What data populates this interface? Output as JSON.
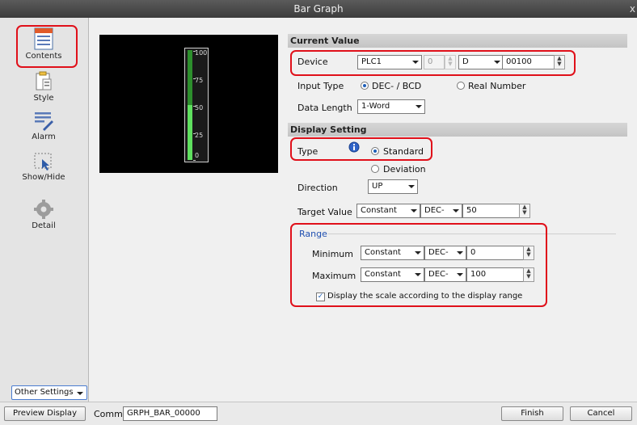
{
  "window": {
    "title": "Bar Graph",
    "close": "x"
  },
  "sidebar": {
    "items": [
      {
        "label": "Contents",
        "icon": "contents-icon",
        "selected": true
      },
      {
        "label": "Style",
        "icon": "style-icon"
      },
      {
        "label": "Alarm",
        "icon": "alarm-icon"
      },
      {
        "label": "Show/Hide",
        "icon": "show-hide-icon"
      },
      {
        "label": "Detail",
        "icon": "detail-icon"
      }
    ],
    "other_settings": "Other Settings"
  },
  "preview": {
    "scale": [
      "100",
      "75",
      "50",
      "25",
      "0"
    ],
    "fill_fraction": 0.5,
    "bar_color": "#2d8f2d",
    "fill_color": "#5fe05f"
  },
  "current_value": {
    "title": "Current Value",
    "device_label": "Device",
    "device": "PLC1",
    "station": "0",
    "device_type": "D",
    "address": "00100",
    "input_type_label": "Input Type",
    "input_dec": "DEC- / BCD",
    "input_real": "Real Number",
    "data_length_label": "Data Length",
    "data_length": "1-Word"
  },
  "display_setting": {
    "title": "Display Setting",
    "type_label": "Type",
    "standard": "Standard",
    "deviation": "Deviation",
    "direction_label": "Direction",
    "direction": "UP",
    "target_label": "Target Value",
    "target_mode": "Constant",
    "target_format": "DEC-",
    "target_value": "50"
  },
  "range": {
    "title": "Range",
    "min_label": "Minimum",
    "min_mode": "Constant",
    "min_format": "DEC-",
    "min_value": "0",
    "max_label": "Maximum",
    "max_mode": "Constant",
    "max_format": "DEC-",
    "max_value": "100",
    "scale_check": "Display the scale according to the display range"
  },
  "footer": {
    "preview_btn": "Preview Display",
    "comm_label": "Comm",
    "comm_value": "GRPH_BAR_00000",
    "finish": "Finish",
    "cancel": "Cancel"
  },
  "colors": {
    "highlight": "#e0101a",
    "section_bg": "#c8c8c8"
  }
}
